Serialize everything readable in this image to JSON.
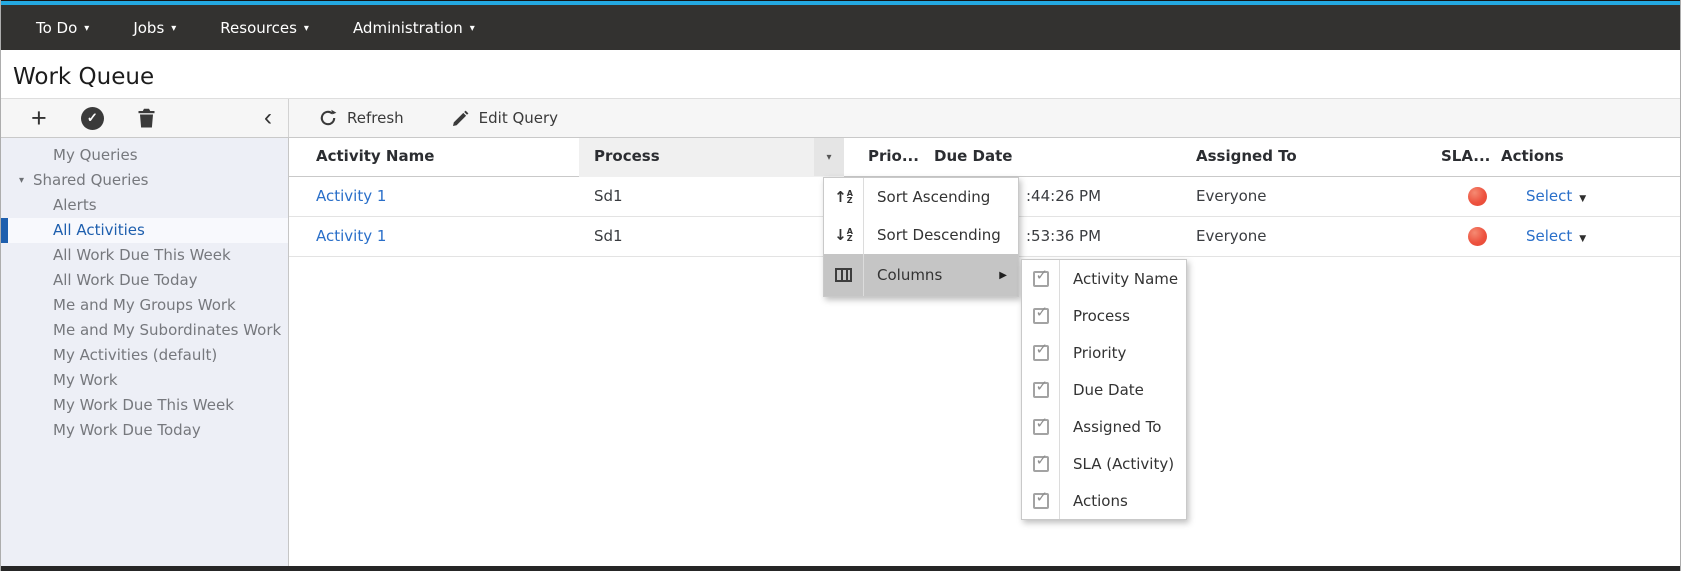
{
  "icons": {
    "caret_down": "▾",
    "caret_down_small": "▼",
    "caret_right": "▶",
    "chevron_left": "‹",
    "plus": "+",
    "check": "✓",
    "arrow_up": "↑",
    "arrow_down": "↓",
    "letter_a": "A",
    "letter_z": "Z"
  },
  "colors": {
    "top_accent": "#24a9e1",
    "navbar_bg": "#333230",
    "link_blue": "#2a6fc9",
    "selected_blue": "#1e5fae",
    "sla_red": "#ed5340",
    "menu_highlight": "#c5c5c5"
  },
  "navbar": {
    "items": [
      {
        "label": "To Do"
      },
      {
        "label": "Jobs"
      },
      {
        "label": "Resources"
      },
      {
        "label": "Administration"
      }
    ]
  },
  "page": {
    "title": "Work Queue"
  },
  "toolbar": {
    "refresh_label": "Refresh",
    "edit_query_label": "Edit Query"
  },
  "sidebar": {
    "items": [
      {
        "label": "My Queries"
      },
      {
        "label": "Shared Queries"
      },
      {
        "label": "Alerts"
      },
      {
        "label": "All Activities"
      },
      {
        "label": "All Work Due This Week"
      },
      {
        "label": "All Work Due Today"
      },
      {
        "label": "Me and My Groups Work"
      },
      {
        "label": "Me and My Subordinates Work"
      },
      {
        "label": "My Activities (default)"
      },
      {
        "label": "My Work"
      },
      {
        "label": "My Work Due This Week"
      },
      {
        "label": "My Work Due Today"
      }
    ]
  },
  "table": {
    "headers": {
      "activity": "Activity Name",
      "process": "Process",
      "priority": "Prio...",
      "due_date": "Due Date",
      "assigned_to": "Assigned To",
      "sla": "SLA...",
      "actions": "Actions"
    },
    "rows": [
      {
        "activity": "Activity 1",
        "process": "Sd1",
        "due_visible": ":44:26 PM",
        "assigned_to": "Everyone",
        "sla_status": "red",
        "action_label": "Select"
      },
      {
        "activity": "Activity 1",
        "process": "Sd1",
        "due_visible": ":53:36 PM",
        "assigned_to": "Everyone",
        "sla_status": "red",
        "action_label": "Select"
      }
    ]
  },
  "column_menu": {
    "items": [
      {
        "label": "Sort Ascending"
      },
      {
        "label": "Sort Descending"
      },
      {
        "label": "Columns"
      }
    ]
  },
  "columns_submenu": {
    "items": [
      {
        "label": "Activity Name",
        "checked": true
      },
      {
        "label": "Process",
        "checked": true
      },
      {
        "label": "Priority",
        "checked": true
      },
      {
        "label": "Due Date",
        "checked": true
      },
      {
        "label": "Assigned To",
        "checked": true
      },
      {
        "label": "SLA (Activity)",
        "checked": true
      },
      {
        "label": "Actions",
        "checked": true
      }
    ]
  }
}
